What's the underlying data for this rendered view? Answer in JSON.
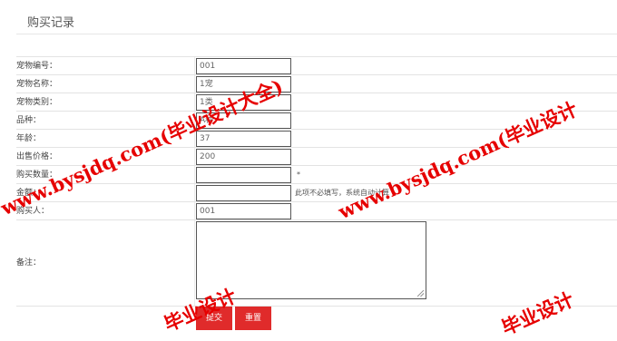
{
  "page": {
    "title": "购买记录"
  },
  "form": {
    "fields": [
      {
        "label": "宠物编号：",
        "value": "001"
      },
      {
        "label": "宠物名称：",
        "value": "1宠"
      },
      {
        "label": "宠物类别：",
        "value": "1类"
      },
      {
        "label": "品种：",
        "value": "A种"
      },
      {
        "label": "年龄：",
        "value": "37"
      },
      {
        "label": "出售价格：",
        "value": "200"
      },
      {
        "label": "购买数量：",
        "value": "",
        "suffix": "*"
      },
      {
        "label": "金额：",
        "value": "",
        "hint": "此项不必填写，系统自动计算"
      },
      {
        "label": "购买人：",
        "value": "001"
      }
    ],
    "remark": {
      "label": "备注：",
      "value": ""
    },
    "buttons": {
      "submit": "提交",
      "reset": "重置"
    }
  },
  "watermarks": [
    "www.bysjdq.com(毕业设计大全)",
    "www.bysjdq.com(毕业设计",
    "毕业设计"
  ],
  "colors": {
    "accent": "#e02b2b",
    "watermark": "#e60000"
  }
}
